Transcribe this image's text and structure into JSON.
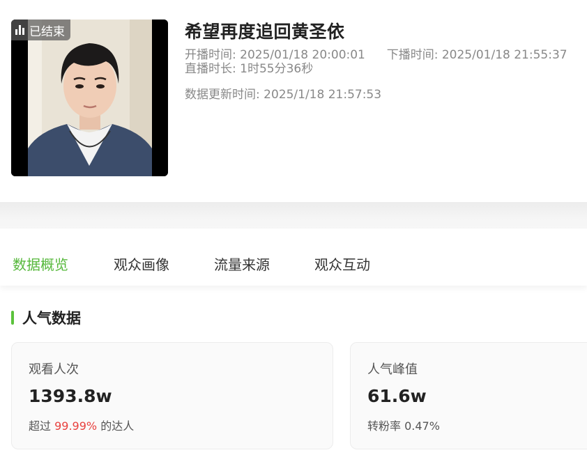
{
  "live": {
    "status_badge": "已结束",
    "title": "希望再度追回黄圣依",
    "start_label": "开播时间:",
    "start_value": "2025/01/18 20:00:01",
    "end_label": "下播时间:",
    "end_value": "2025/01/18 21:55:37",
    "duration_label": "直播时长:",
    "duration_value": "1时55分36秒",
    "update_label": "数据更新时间:",
    "update_value": "2025/1/18 21:57:53"
  },
  "tabs": [
    {
      "label": "数据概览",
      "active": true
    },
    {
      "label": "观众画像",
      "active": false
    },
    {
      "label": "流量来源",
      "active": false
    },
    {
      "label": "观众互动",
      "active": false
    }
  ],
  "section": {
    "title": "人气数据"
  },
  "cards": [
    {
      "label": "观看人次",
      "value": "1393.8w",
      "sub_prefix": "超过",
      "sub_highlight": "99.99%",
      "sub_suffix": "的达人"
    },
    {
      "label": "人气峰值",
      "value": "61.6w",
      "sub_prefix": "转粉率",
      "sub_value": "0.47%"
    }
  ],
  "colors": {
    "accent_green": "#56b83b",
    "highlight_red": "#e8403e"
  },
  "icons": {
    "status": "bar-chart-icon"
  }
}
